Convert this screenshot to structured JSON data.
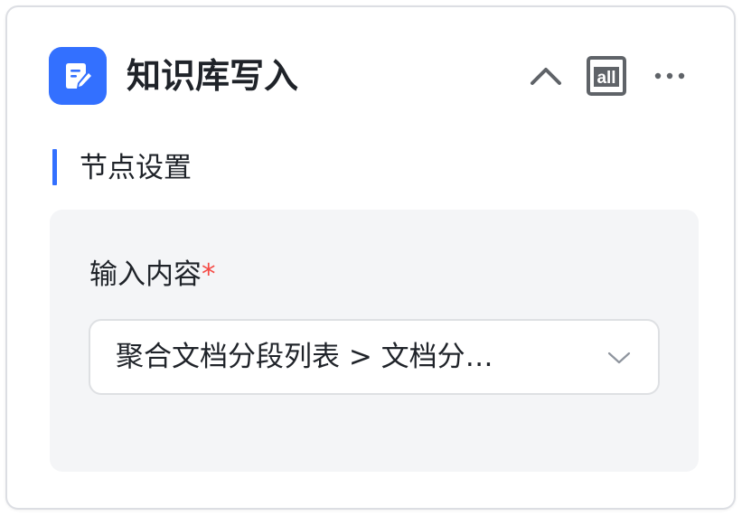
{
  "node": {
    "title": "知识库写入",
    "icon": "edit-document-icon",
    "accent_color": "#3370ff"
  },
  "header_actions": {
    "collapse_icon": "chevron-up-icon",
    "all_label": "all",
    "more_icon": "more-horizontal-icon"
  },
  "section": {
    "title": "节点设置"
  },
  "input_field": {
    "label": "输入内容",
    "required_mark": "*",
    "selected_value": "聚合文档分段列表 > 文档分…",
    "dropdown_icon": "chevron-down-icon"
  }
}
